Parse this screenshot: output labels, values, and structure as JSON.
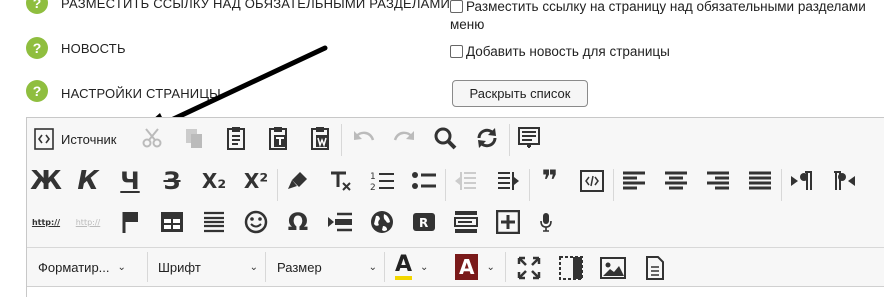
{
  "settings": {
    "link_above": {
      "label": "РАЗМЕСТИТЬ ССЫЛКУ НАД ОБЯЗАТЕЛЬНЫМИ РАЗДЕЛАМИ",
      "checkbox_line1": "Разместить ссылку на страницу над обязательными разделами",
      "checkbox_line2": "меню",
      "checked": false
    },
    "news": {
      "label": "НОВОСТЬ",
      "checkbox": "Добавить новость для страницы",
      "checked": false
    },
    "page_settings": {
      "label": "НАСТРОЙКИ СТРАНИЦЫ",
      "button": "Раскрыть список"
    },
    "help_glyph": "?"
  },
  "editor": {
    "source_label": "Источник",
    "row2_glyphs": {
      "bold": "Ж",
      "italic": "К",
      "underline": "Ч",
      "strike": "З",
      "subscript": "X₂",
      "superscript": "X²",
      "quote": "❞"
    },
    "row3_glyphs": {
      "link": "http://",
      "unlink": "http://"
    },
    "combos": {
      "format": "Форматир...",
      "font": "Шрифт",
      "size": "Размер",
      "text_color_letter": "A",
      "bg_color_letter": "A"
    },
    "colors": {
      "accent_green": "#8fbe3f",
      "text_color_underline": "#f2d600",
      "bg_color_fill": "#7a1a1a"
    },
    "icons": [
      "source-icon",
      "cut-icon",
      "copy-icon",
      "paste-icon",
      "paste-text-icon",
      "paste-word-icon",
      "undo-icon",
      "redo-icon",
      "find-icon",
      "replace-icon",
      "template-icon",
      "bold-icon",
      "italic-icon",
      "underline-icon",
      "strike-icon",
      "subscript-icon",
      "superscript-icon",
      "eraser-icon",
      "remove-format-icon",
      "ordered-list-icon",
      "bullet-list-icon",
      "outdent-icon",
      "indent-icon",
      "blockquote-icon",
      "div-icon",
      "align-left-icon",
      "align-center-icon",
      "align-right-icon",
      "justify-icon",
      "ltr-icon",
      "rtl-icon",
      "link-icon",
      "unlink-icon",
      "anchor-icon",
      "table-icon",
      "horizontal-rule-icon",
      "smiley-icon",
      "omega-icon",
      "page-break-icon",
      "globe-icon",
      "r-icon",
      "form-icon",
      "plus-box-icon",
      "microphone-icon",
      "maximize-icon",
      "show-blocks-icon",
      "image-icon",
      "page-icon"
    ]
  }
}
